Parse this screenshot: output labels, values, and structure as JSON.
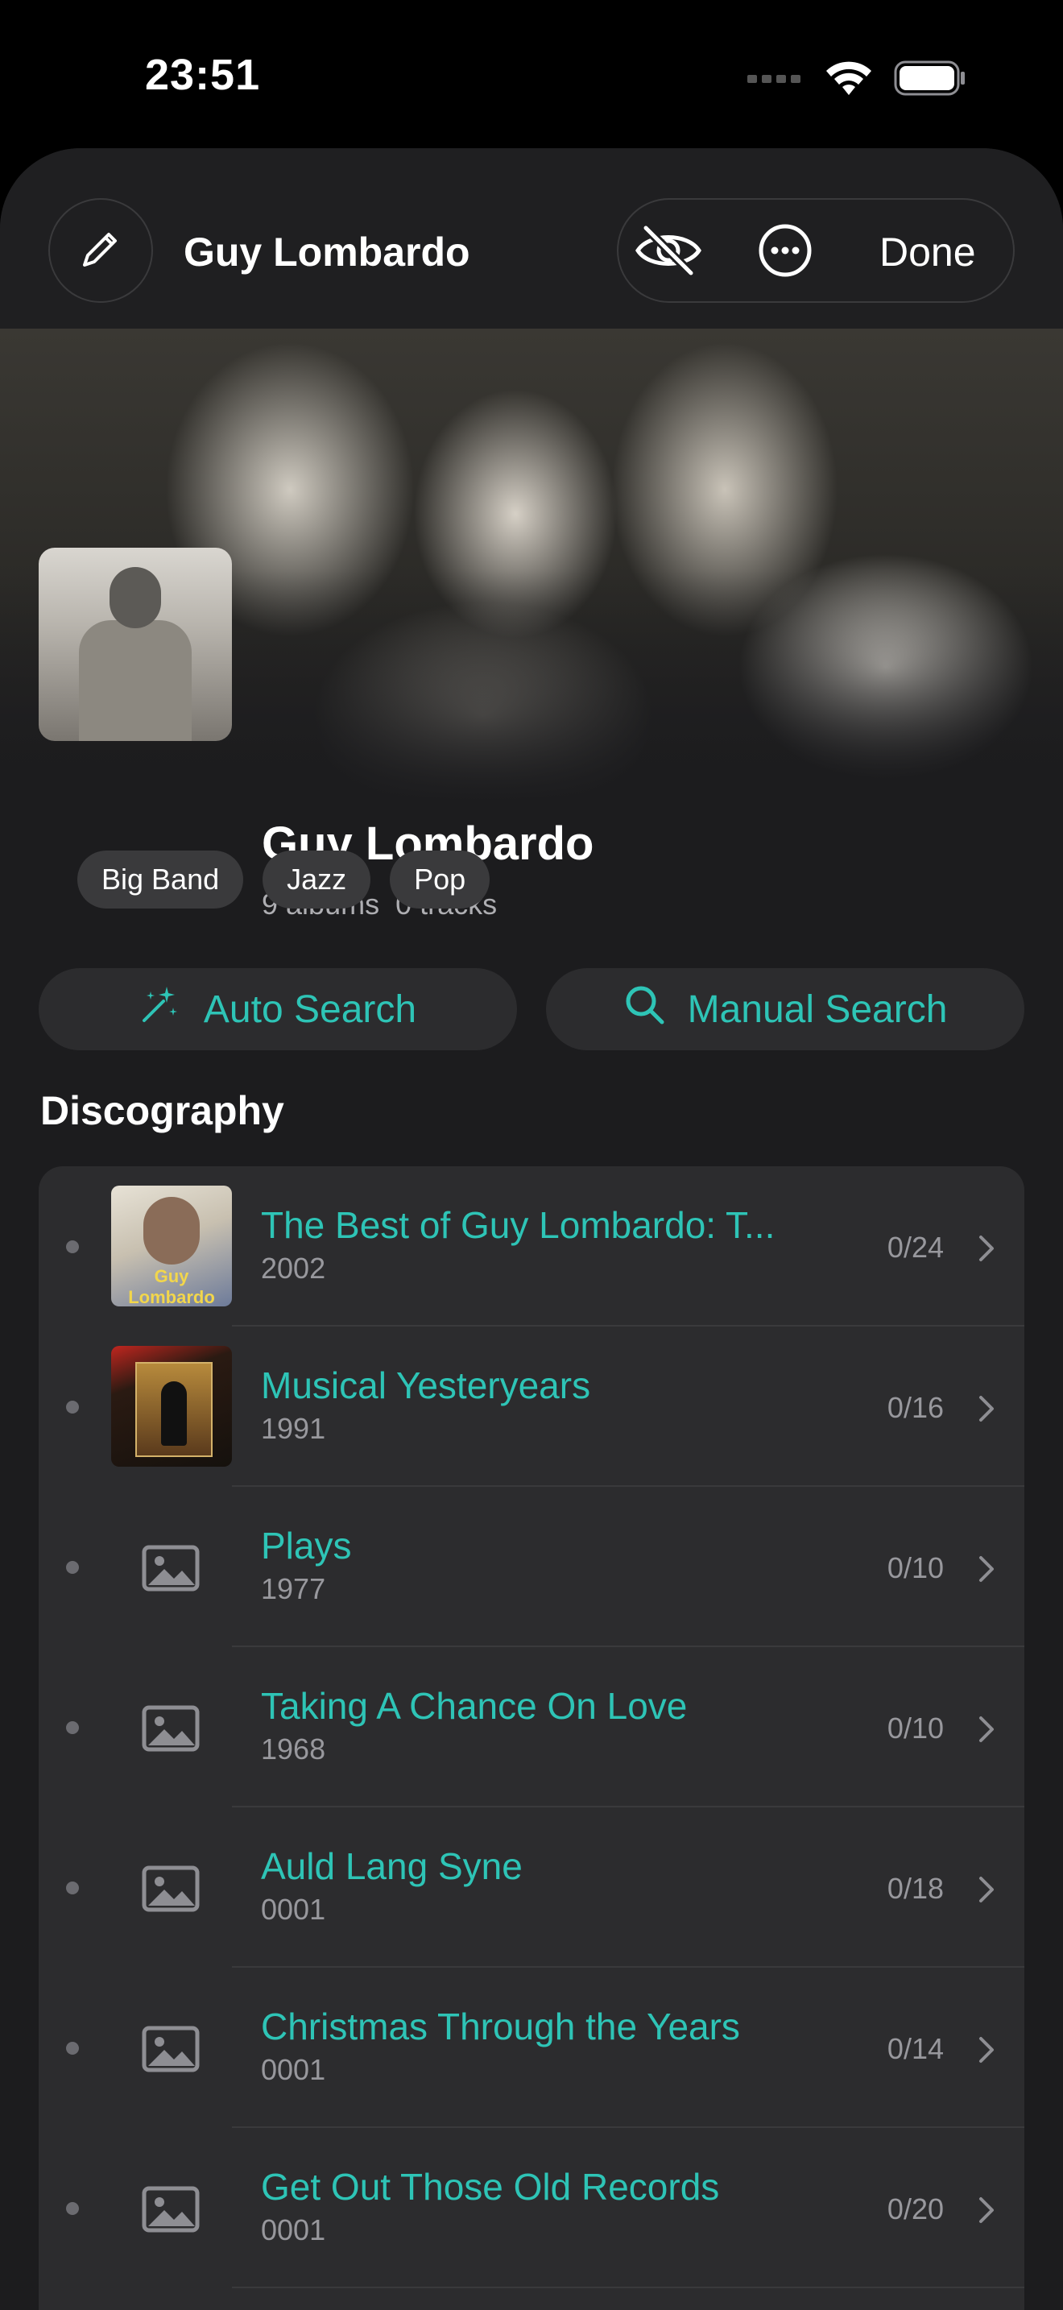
{
  "status_bar": {
    "time": "23:51"
  },
  "header": {
    "title": "Guy Lombardo",
    "done_label": "Done",
    "icons": {
      "edit": "pencil-icon",
      "hide": "eye-slash-icon",
      "more": "ellipsis-circle-icon"
    }
  },
  "artist": {
    "name": "Guy Lombardo",
    "albums": "9 albums",
    "tracks": "0 tracks"
  },
  "genres": [
    "Big Band",
    "Jazz",
    "Pop"
  ],
  "actions": {
    "auto_search": "Auto Search",
    "manual_search": "Manual Search"
  },
  "discography": {
    "title": "Discography",
    "albums": [
      {
        "title": "The Best of Guy Lombardo: T...",
        "year": "2002",
        "count": "0/24",
        "cover_text": "Guy Lombardo"
      },
      {
        "title": "Musical Yesteryears",
        "year": "1991",
        "count": "0/16"
      },
      {
        "title": "Plays",
        "year": "1977",
        "count": "0/10"
      },
      {
        "title": "Taking A Chance On Love",
        "year": "1968",
        "count": "0/10"
      },
      {
        "title": "Auld Lang Syne",
        "year": "0001",
        "count": "0/18"
      },
      {
        "title": "Christmas Through the Years",
        "year": "0001",
        "count": "0/14"
      },
      {
        "title": "Get Out Those Old Records",
        "year": "0001",
        "count": "0/20"
      }
    ]
  },
  "colors": {
    "accent": "#2ec4b6",
    "background": "#1c1c1e",
    "card": "#2c2c2e"
  }
}
